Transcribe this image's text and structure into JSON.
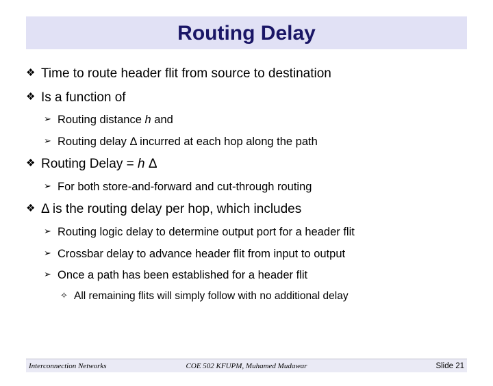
{
  "title": "Routing Delay",
  "bullets": {
    "b1": "Time to route header flit  from source to destination",
    "b2": "Is a function of",
    "b2a_pre": "Routing distance ",
    "b2a_ital": "h",
    "b2a_post": " and",
    "b2b": "Routing delay Δ incurred at each hop along the path",
    "b3_pre": "Routing Delay = ",
    "b3_ital": "h",
    "b3_post": " Δ",
    "b3a": "For both store-and-forward and cut-through routing",
    "b4": "Δ is the routing delay per hop, which includes",
    "b4a": "Routing logic delay to determine output port for a header flit",
    "b4b": "Crossbar delay to advance header flit from input to output",
    "b4c": "Once a path has been established for a header flit",
    "b4c1": "All remaining flits will simply follow with no additional delay"
  },
  "footer": {
    "left": "Interconnection Networks",
    "mid": "COE 502 KFUPM, Muhamed Mudawar",
    "right": "Slide 21"
  }
}
